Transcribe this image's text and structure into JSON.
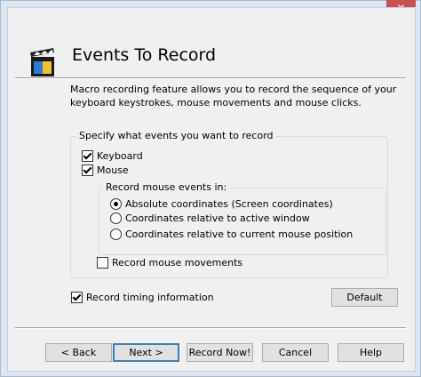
{
  "window": {
    "close_glyph": "✕"
  },
  "header": {
    "icon": "clapperboard-icon",
    "title": "Events To Record"
  },
  "description": "Macro recording feature allows you to record the sequence of your keyboard keystrokes, mouse movements and mouse clicks.",
  "events_group": {
    "legend": "Specify what events you want to record",
    "keyboard": {
      "label": "Keyboard",
      "checked": true
    },
    "mouse": {
      "label": "Mouse",
      "checked": true
    },
    "mouse_events_group": {
      "legend": "Record mouse events in:",
      "options": [
        {
          "label": "Absolute coordinates (Screen coordinates)",
          "selected": true
        },
        {
          "label": "Coordinates relative to active window",
          "selected": false
        },
        {
          "label": "Coordinates relative to current mouse position",
          "selected": false
        }
      ]
    },
    "record_movements": {
      "label": "Record mouse movements",
      "checked": false
    }
  },
  "timing": {
    "label": "Record timing information",
    "checked": true
  },
  "default_button": "Default",
  "footer": {
    "back": "< Back",
    "next": "Next >",
    "record_now": "Record Now!",
    "cancel": "Cancel",
    "help": "Help"
  }
}
